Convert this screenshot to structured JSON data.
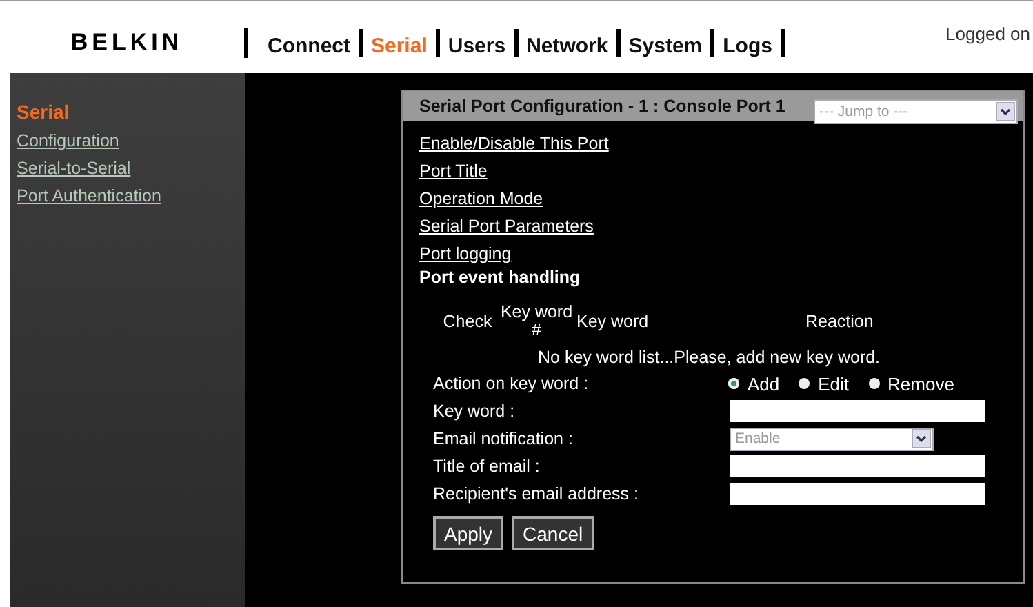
{
  "header": {
    "logo": "BELKIN",
    "nav": [
      {
        "label": "Connect",
        "selected": false
      },
      {
        "label": "Serial",
        "selected": true
      },
      {
        "label": "Users",
        "selected": false
      },
      {
        "label": "Network",
        "selected": false
      },
      {
        "label": "System",
        "selected": false
      },
      {
        "label": "Logs",
        "selected": false
      }
    ],
    "login_status": "Logged on"
  },
  "sidebar": {
    "title": "Serial",
    "items": [
      "Configuration",
      "Serial-to-Serial",
      "Port Authentication"
    ]
  },
  "panel": {
    "title": "Serial Port Configuration - 1 : Console Port 1",
    "jump_select": {
      "placeholder": "--- Jump to ---"
    },
    "links": [
      "Enable/Disable This Port",
      "Port Title",
      "Operation Mode",
      "Serial Port Parameters",
      "Port logging"
    ],
    "section_title": "Port event handling",
    "table_columns": [
      "Check",
      "Key word #",
      "Key word",
      "Reaction"
    ],
    "empty_message": "No key word list...Please, add new key word.",
    "form": [
      {
        "kind": "radio",
        "label": "Action on key word :",
        "options": [
          {
            "label": "Add",
            "selected": true
          },
          {
            "label": "Edit",
            "selected": false
          },
          {
            "label": "Remove",
            "selected": false
          }
        ]
      },
      {
        "kind": "text",
        "label": "Key word :"
      },
      {
        "kind": "select",
        "label": "Email notification :",
        "value": "Enable"
      },
      {
        "kind": "text",
        "label": "Title of email :"
      },
      {
        "kind": "text",
        "label": "Recipient's email address :"
      }
    ],
    "buttons": [
      "Apply",
      "Cancel"
    ]
  }
}
